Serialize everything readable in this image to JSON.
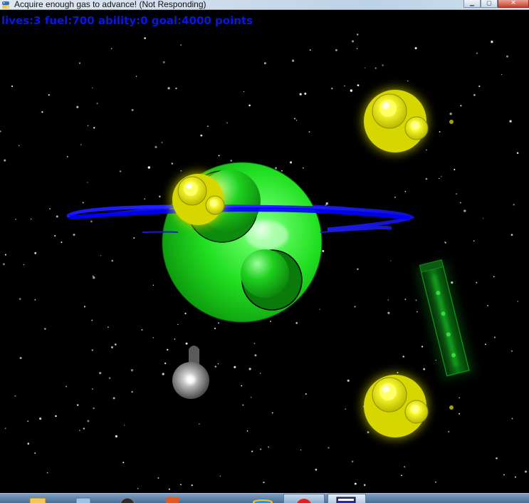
{
  "window": {
    "title": "Acquire enough gas to  advance! (Not Responding)",
    "controls": {
      "minimize_icon": "minimize-icon",
      "maximize_icon": "maximize-icon",
      "close_icon": "close-icon"
    }
  },
  "hud": {
    "text": "lives:3 fuel:700 ability:0 goal:4000 points",
    "lives": 3,
    "fuel": 700,
    "ability": 0,
    "goal_points": 4000,
    "color": "#0a16e8"
  },
  "scene": {
    "background": "#000000",
    "planet": {
      "name": "planet",
      "color": "#2ee02e",
      "ring_color": "#1010ff"
    },
    "player_ship": {
      "name": "player-ship",
      "color": "#d8d8d8"
    },
    "gas_orbs": [
      {
        "name": "gas-orb"
      },
      {
        "name": "gas-orb"
      },
      {
        "name": "gas-orb"
      }
    ],
    "orb_color": "#f2f200",
    "fuel_canister": {
      "name": "fuel-canister",
      "color": "#0e8f1a"
    }
  },
  "taskbar": {
    "items": [
      "folder-icon",
      "window-icon",
      "media-icon",
      "office-icon",
      "ie-icon",
      "record-icon",
      "app-icon"
    ]
  }
}
